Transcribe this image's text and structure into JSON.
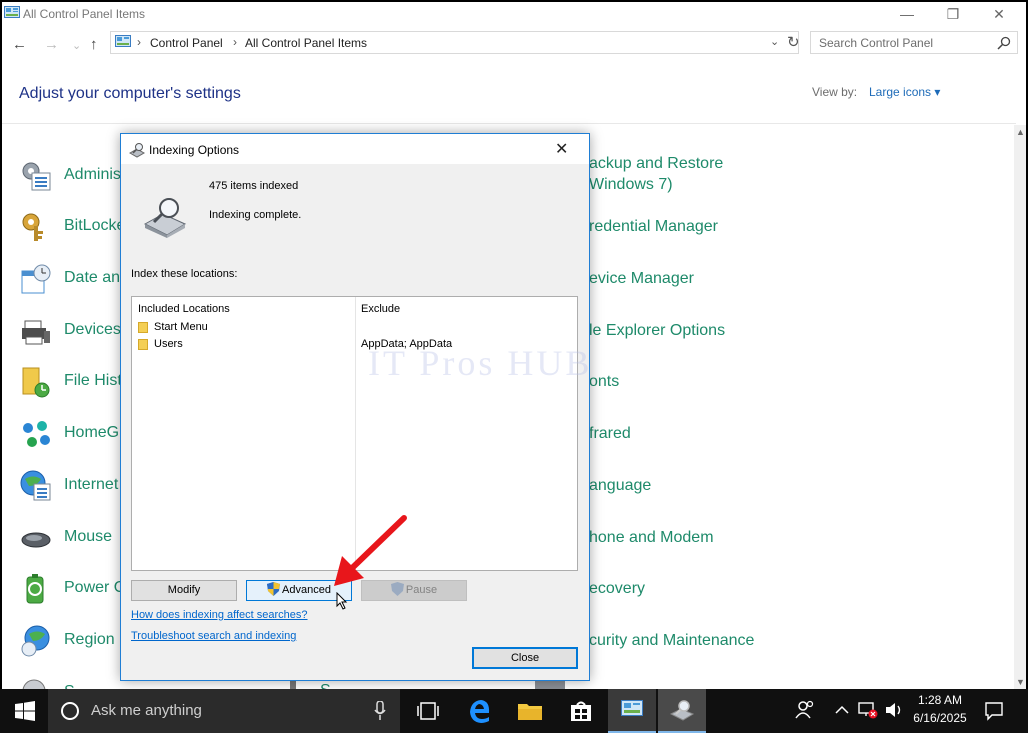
{
  "window": {
    "title": "All Control Panel Items",
    "min": "—",
    "max": "❐",
    "close": "✕"
  },
  "nav": {
    "back": "←",
    "forward": "→",
    "up": "↑",
    "crumb1": "Control Panel",
    "crumb2": "All Control Panel Items",
    "sep": "›",
    "dropdown": "⌄",
    "refresh": "↻",
    "search_placeholder": "Search Control Panel"
  },
  "header": {
    "title": "Adjust your computer's settings",
    "view_by_label": "View by:",
    "view_by_value": "Large icons ▾"
  },
  "left_items": [
    {
      "label": "Adminis"
    },
    {
      "label": "BitLocke"
    },
    {
      "label": "Date an"
    },
    {
      "label": "Devices"
    },
    {
      "label": "File Hist"
    },
    {
      "label": "HomeG"
    },
    {
      "label": "Internet"
    },
    {
      "label": "Mouse"
    },
    {
      "label": "Power O"
    },
    {
      "label": "Region"
    },
    {
      "label": "S"
    }
  ],
  "right_items": [
    {
      "line1": "ackup and Restore",
      "line2": "Windows 7)"
    },
    {
      "line1": "redential Manager"
    },
    {
      "line1": "evice Manager"
    },
    {
      "line1": "le Explorer Options"
    },
    {
      "line1": "onts"
    },
    {
      "line1": "frared"
    },
    {
      "line1": "anguage"
    },
    {
      "line1": "hone and Modem"
    },
    {
      "line1": "ecovery"
    },
    {
      "line1": "curity and Maintenance"
    }
  ],
  "dialog": {
    "title": "Indexing Options",
    "close": "✕",
    "items_indexed": "475 items indexed",
    "status": "Indexing complete.",
    "locations_label": "Index these locations:",
    "col_included": "Included Locations",
    "col_exclude": "Exclude",
    "locations": [
      {
        "name": "Start Menu",
        "exclude": ""
      },
      {
        "name": "Users",
        "exclude": "AppData; AppData"
      }
    ],
    "modify": "Modify",
    "advanced": "Advanced",
    "pause": "Pause",
    "link1": "How does indexing affect searches?",
    "link2": "Troubleshoot search and indexing",
    "close_button": "Close"
  },
  "watermark": "IT Pros HUB",
  "taskbar": {
    "search_text": "Ask me anything",
    "time": "1:28 AM",
    "date": "6/16/2025"
  },
  "colors": {
    "link_green": "#1e8a6a",
    "heading_blue": "#1e3287",
    "accent": "#0078d7",
    "arrow_red": "#e8161b"
  }
}
